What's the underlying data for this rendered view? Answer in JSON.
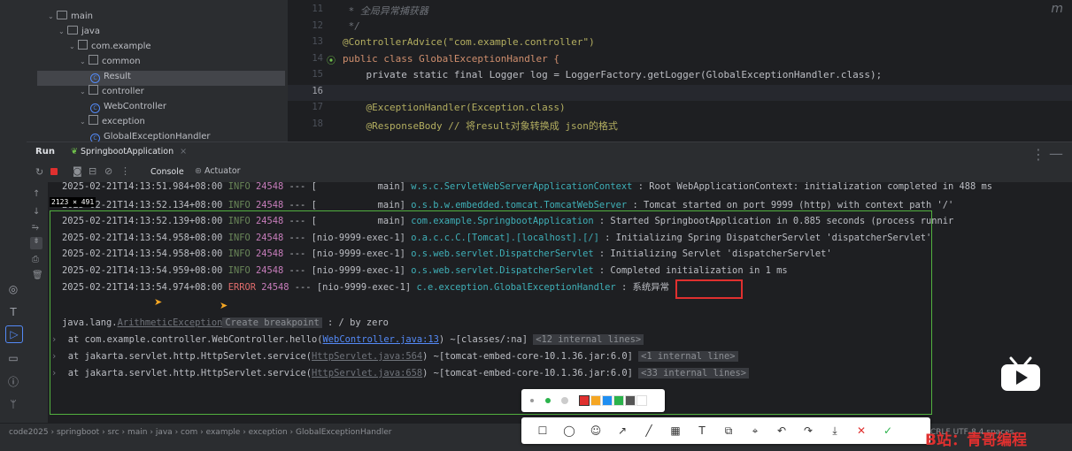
{
  "tree": {
    "items": [
      {
        "label": "main",
        "kind": "folder",
        "depth": 3
      },
      {
        "label": "java",
        "kind": "folder-src",
        "depth": 4
      },
      {
        "label": "com.example",
        "kind": "package",
        "depth": 5
      },
      {
        "label": "common",
        "kind": "package",
        "depth": 6
      },
      {
        "label": "Result",
        "kind": "class",
        "depth": 7
      },
      {
        "label": "controller",
        "kind": "package",
        "depth": 6
      },
      {
        "label": "WebController",
        "kind": "class",
        "depth": 7
      },
      {
        "label": "exception",
        "kind": "package",
        "depth": 6
      },
      {
        "label": "GlobalExceptionHandler",
        "kind": "class",
        "depth": 7
      }
    ]
  },
  "editor": {
    "lines": [
      {
        "n": "11",
        "text": " * 全局异常捕获器",
        "kind": "comment"
      },
      {
        "n": "12",
        "text": " */",
        "kind": "comment"
      },
      {
        "n": "13",
        "text": "@ControllerAdvice(\"com.example.controller\")",
        "kind": "annotation"
      },
      {
        "n": "14",
        "text": "public class GlobalExceptionHandler {",
        "kind": "decl"
      },
      {
        "n": "15",
        "text": "    private static final Logger log = LoggerFactory.getLogger(GlobalExceptionHandler.class);",
        "kind": "field"
      },
      {
        "n": "16",
        "text": "",
        "kind": "blank"
      },
      {
        "n": "17",
        "text": "    @ExceptionHandler(Exception.class)",
        "kind": "annotation"
      },
      {
        "n": "18",
        "text": "    @ResponseBody // 将result对象转换成 json的格式",
        "kind": "annotation"
      }
    ],
    "corner_letter": "m"
  },
  "run": {
    "label": "Run",
    "tab": "SpringbootApplication",
    "console_tab": "Console",
    "actuator_tab": "Actuator"
  },
  "console": {
    "lines": [
      {
        "ts": "2025-02-21T14:13:51.984+08:00",
        "lvl": "INFO",
        "pid": "24548",
        "sep": "---",
        "thread": "[           main]",
        "logger": "w.s.c.ServletWebServerApplicationContext",
        "msg": ": Root WebApplicationContext: initialization completed in 488 ms"
      },
      {
        "ts": "2025-02-21T14:13:52.134+08:00",
        "lvl": "INFO",
        "pid": "24548",
        "sep": "---",
        "thread": "[           main]",
        "logger": "o.s.b.w.embedded.tomcat.TomcatWebServer",
        "msg": ": Tomcat started on port 9999 (http) with context path '/'"
      },
      {
        "ts": "2025-02-21T14:13:52.139+08:00",
        "lvl": "INFO",
        "pid": "24548",
        "sep": "---",
        "thread": "[           main]",
        "logger": "com.example.SpringbootApplication",
        "msg": ": Started SpringbootApplication in 0.885 seconds (process runnir"
      },
      {
        "ts": "2025-02-21T14:13:54.958+08:00",
        "lvl": "INFO",
        "pid": "24548",
        "sep": "---",
        "thread": "[nio-9999-exec-1]",
        "logger": "o.a.c.c.C.[Tomcat].[localhost].[/]",
        "msg": ": Initializing Spring DispatcherServlet 'dispatcherServlet'"
      },
      {
        "ts": "2025-02-21T14:13:54.958+08:00",
        "lvl": "INFO",
        "pid": "24548",
        "sep": "---",
        "thread": "[nio-9999-exec-1]",
        "logger": "o.s.web.servlet.DispatcherServlet",
        "msg": ": Initializing Servlet 'dispatcherServlet'"
      },
      {
        "ts": "2025-02-21T14:13:54.959+08:00",
        "lvl": "INFO",
        "pid": "24548",
        "sep": "---",
        "thread": "[nio-9999-exec-1]",
        "logger": "o.s.web.servlet.DispatcherServlet",
        "msg": ": Completed initialization in 1 ms"
      },
      {
        "ts": "2025-02-21T14:13:54.974+08:00",
        "lvl": "ERROR",
        "pid": "24548",
        "sep": "---",
        "thread": "[nio-9999-exec-1]",
        "logger": "c.e.exception.GlobalExceptionHandler",
        "msg": ": 系统异常"
      }
    ],
    "exception_prefix": "java.lang.",
    "exception_class": "ArithmeticException",
    "create_breakpoint": "Create breakpoint",
    "exception_msg": ": / by zero",
    "stack": [
      {
        "pre": "at com.example.controller.WebController.hello(",
        "link": "WebController.java:13",
        "post": ") ~[classes/:na]",
        "chip": "<12 internal lines>"
      },
      {
        "pre": "at jakarta.servlet.http.HttpServlet.service(",
        "link": "HttpServlet.java:564",
        "post": ") ~[tomcat-embed-core-10.1.36.jar:6.0]",
        "chip": "<1 internal line>"
      },
      {
        "pre": "at jakarta.servlet.http.HttpServlet.service(",
        "link": "HttpServlet.java:658",
        "post": ") ~[tomcat-embed-core-10.1.36.jar:6.0]",
        "chip": "<33 internal lines>"
      }
    ],
    "selection_size": "2123 × 491"
  },
  "status": {
    "crumbs": [
      "code2025",
      "springboot",
      "src",
      "main",
      "java",
      "com",
      "example",
      "exception",
      "GlobalExceptionHandler"
    ],
    "right": "CRLF  UTF-8  4 spaces"
  },
  "annotation": {
    "colors": [
      "#e0302f",
      "#f5a623",
      "#1f8ef1",
      "#2bb34b",
      "#555555",
      "#ffffff"
    ],
    "tools": [
      "rect-tool",
      "ellipse-tool",
      "emoji-tool",
      "arrow-tool",
      "line-tool",
      "mosaic-tool",
      "text-tool",
      "pin-tool",
      "scroll-tool",
      "undo-tool",
      "share-tool",
      "save-tool",
      "cancel-tool",
      "confirm-tool"
    ]
  },
  "watermark": "B站：青哥编程"
}
